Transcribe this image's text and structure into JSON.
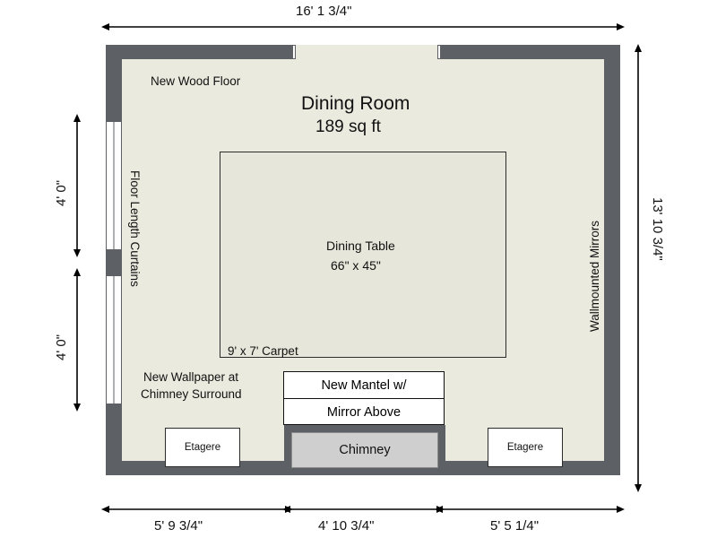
{
  "plan": {
    "room_name": "Dining Room",
    "room_area": "189 sq ft",
    "colors": {
      "wall": "#5d6165",
      "floor": "#eaeadf",
      "carpet": "#e6e6da",
      "chimney": "#cfcfcf",
      "furniture": "#ffffff",
      "line": "#111111"
    }
  },
  "dimensions": {
    "top_overall": "16' 1 3/4\"",
    "right_overall": "13' 10 3/4\"",
    "left_upper": "4' 0\"",
    "left_lower": "4' 0\"",
    "bottom_left": "5' 9 3/4\"",
    "bottom_center": "4' 10 3/4\"",
    "bottom_right": "5' 5 1/4\""
  },
  "annotations": {
    "new_wood_floor": "New Wood Floor",
    "floor_length_curtains": "Floor Length Curtains",
    "wallmounted_mirrors": "Wallmounted Mirrors",
    "new_wallpaper_line1": "New Wallpaper at",
    "new_wallpaper_line2": "Chimney Surround"
  },
  "furniture": {
    "table_label_line1": "Dining Table",
    "table_label_line2": "66\" x 45\"",
    "carpet_label": "9' x 7' Carpet",
    "mantel_line1": "New Mantel w/",
    "mantel_line2": "Mirror Above",
    "chimney_label": "Chimney",
    "etagere_left": "Etagere",
    "etagere_right": "Etagere"
  }
}
